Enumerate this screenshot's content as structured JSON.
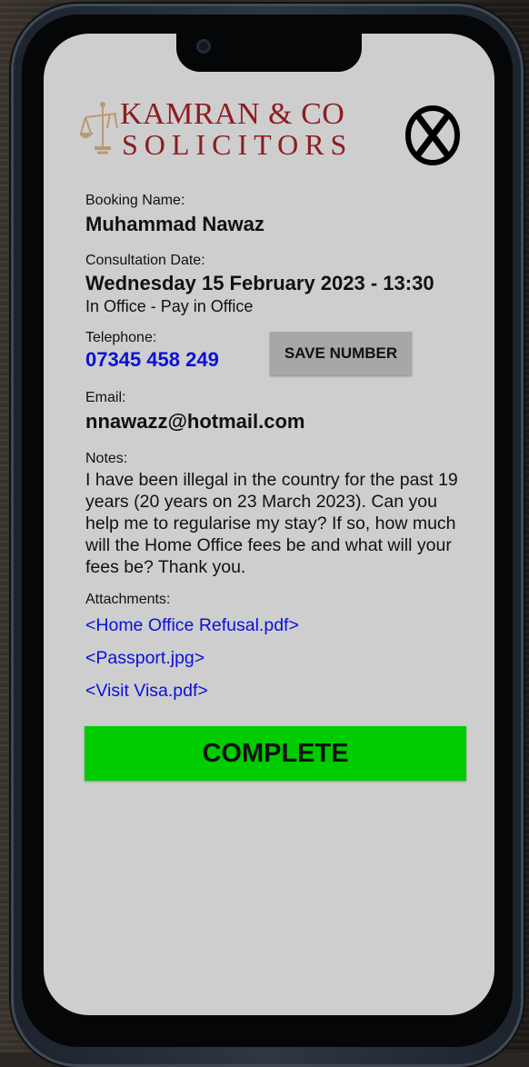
{
  "brand": {
    "line1": "KAMRAN & CO",
    "line2": "SOLICITORS",
    "color": "#8c1d20"
  },
  "close_icon": "close-circle-x-icon",
  "booking": {
    "name_label": "Booking Name:",
    "name_value": "Muhammad Nawaz",
    "date_label": "Consultation Date:",
    "date_value": "Wednesday 15 February 2023 - 13:30",
    "mode_value": "In Office - Pay in Office",
    "phone_label": "Telephone:",
    "phone_value": "07345 458 249",
    "save_number_label": "SAVE NUMBER",
    "email_label": "Email:",
    "email_value": "nnawazz@hotmail.com",
    "notes_label": "Notes:",
    "notes_value": "I have been illegal in the country for the past 19 years (20 years on 23 March 2023). Can you help me to regularise my stay? If so, how much will the Home Office fees be and what will your fees be? Thank you."
  },
  "attachments": {
    "label": "Attachments:",
    "items": [
      "<Home Office Refusal.pdf>",
      "<Passport.jpg>",
      "<Visit Visa.pdf>"
    ]
  },
  "complete_label": "COMPLETE",
  "colors": {
    "screen_bg": "#cecece",
    "link": "#0a10d9",
    "complete_green": "#00cc00",
    "save_button_gray": "#a7a7a7"
  }
}
